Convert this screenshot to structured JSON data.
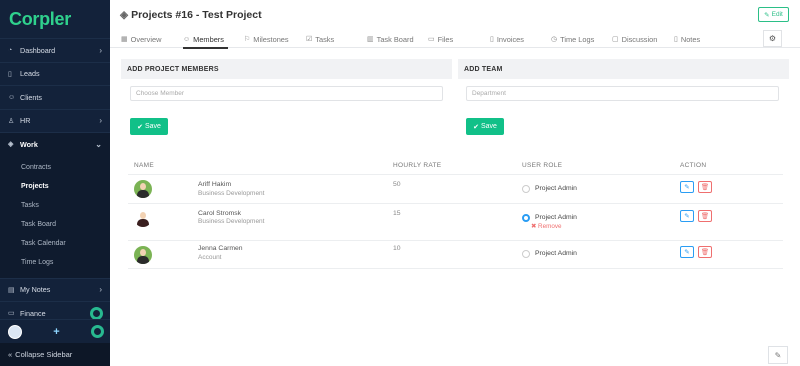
{
  "app": {
    "logo": "Corpler"
  },
  "sidebar": {
    "dashboard": "Dashboard",
    "leads": "Leads",
    "clients": "Clients",
    "hr": "HR",
    "work": "Work",
    "work_items": [
      "Contracts",
      "Projects",
      "Tasks",
      "Task Board",
      "Task Calendar",
      "Time Logs"
    ],
    "my_notes": "My Notes",
    "finance": "Finance",
    "collapse": "Collapse Sidebar"
  },
  "header": {
    "title": "Projects #16 - Test Project",
    "edit": "Edit"
  },
  "tabs": [
    "Overview",
    "Members",
    "Milestones",
    "Tasks",
    "Task Board",
    "Files",
    "Invoices",
    "Time Logs",
    "Discussion",
    "Notes"
  ],
  "add_members": {
    "heading": "ADD PROJECT MEMBERS",
    "placeholder": "Choose Member",
    "save": "Save"
  },
  "add_team": {
    "heading": "ADD TEAM",
    "placeholder": "Department",
    "save": "Save"
  },
  "table": {
    "headers": [
      "NAME",
      "HOURLY RATE",
      "USER ROLE",
      "ACTION"
    ],
    "rows": [
      {
        "name": "Ariff Hakim",
        "dept": "Business Development",
        "rate": "50",
        "role": "Project Admin",
        "selected": false,
        "remove": ""
      },
      {
        "name": "Carol Stromsk",
        "dept": "Business Development",
        "rate": "15",
        "role": "Project Admin",
        "selected": true,
        "remove": "Remove"
      },
      {
        "name": "Jenna Carmen",
        "dept": "Account",
        "rate": "10",
        "role": "Project Admin",
        "selected": false,
        "remove": ""
      }
    ]
  },
  "colors": {
    "sidebar_bg": "#13223a",
    "accent_green": "#11c088",
    "link_blue": "#2a9df4",
    "danger_red": "#ef6f6f"
  }
}
